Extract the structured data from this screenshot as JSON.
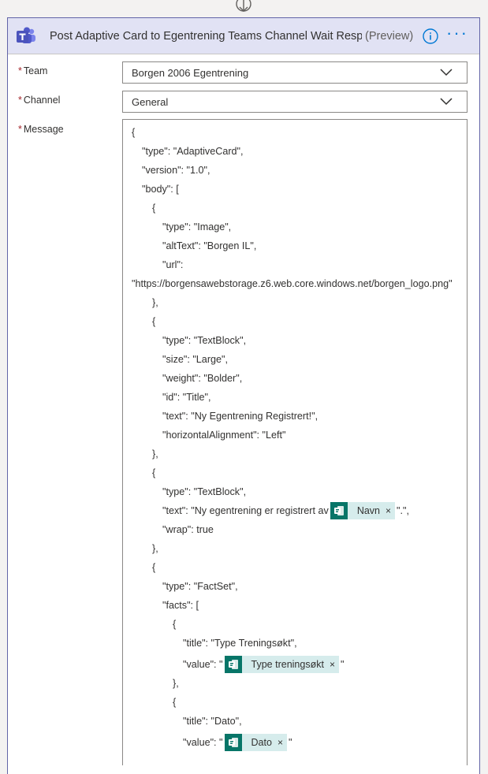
{
  "header": {
    "title": "Post Adaptive Card to Egentrening Teams Channel Wait Respo...",
    "preview": "(Preview)",
    "more_label": "···"
  },
  "icons": {
    "app": "microsoft-teams-icon",
    "info": "info-icon",
    "more": "more-options-icon",
    "chevron": "chevron-down-icon",
    "token": "microsoft-forms-icon",
    "remove": "close-icon"
  },
  "colors": {
    "header_bg": "#e1e2f4",
    "accent": "#6264a7",
    "link": "#0078d4",
    "required": "#a4262c",
    "token_bg": "#d6ecec",
    "token_icon_bg": "#077568"
  },
  "fields": {
    "team": {
      "label": "Team",
      "value": "Borgen 2006 Egentrening"
    },
    "channel": {
      "label": "Channel",
      "value": "General"
    },
    "message": {
      "label": "Message"
    }
  },
  "required_mark": "*",
  "message_lines": [
    "{",
    "\"type\": \"AdaptiveCard\",",
    "\"version\": \"1.0\",",
    "\"body\": [",
    "{",
    "\"type\": \"Image\",",
    "\"altText\": \"Borgen IL\",",
    "\"url\":",
    "\"https://borgensawebstorage.z6.web.core.windows.net/borgen_logo.png\"",
    "},",
    "{",
    "\"type\": \"TextBlock\",",
    "\"size\": \"Large\",",
    "\"weight\": \"Bolder\",",
    "\"id\": \"Title\",",
    "\"text\": \"Ny Egentrening Registrert!\",",
    "\"horizontalAlignment\": \"Left\"",
    "},",
    "{",
    "\"type\": \"TextBlock\",",
    "\"text\": \"Ny egentrening er registrert av",
    "\".\",",
    "\"wrap\": true",
    "},",
    "{",
    "\"type\": \"FactSet\",",
    "\"facts\": [",
    "{",
    "\"title\": \"Type Treningsøkt\",",
    "\"value\": \"",
    "\"",
    "},",
    "{",
    "\"title\": \"Dato\",",
    "\"value\": \"",
    "\""
  ],
  "tokens": {
    "navn": "Navn",
    "type_treningsokt": "Type treningsøkt",
    "dato": "Dato",
    "remove": "×"
  }
}
